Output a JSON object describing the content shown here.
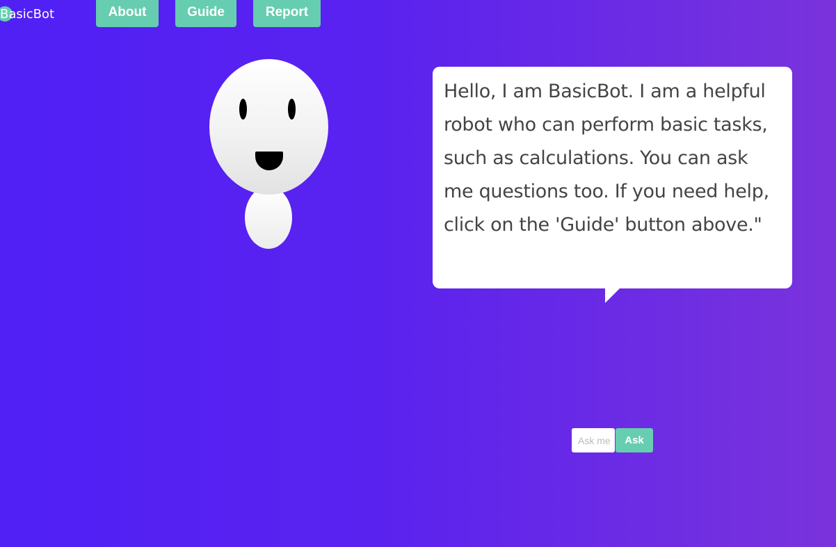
{
  "app": {
    "name": "BasicBot"
  },
  "nav": {
    "about_label": "About",
    "guide_label": "Guide",
    "report_label": "Report"
  },
  "bubble": {
    "message": "Hello, I am BasicBot. I am a helpful robot who can perform basic tasks, such as calculations. You can ask me questions too. If you need help, click on the 'Guide' button above.\""
  },
  "ask": {
    "placeholder": "Ask me",
    "value": "",
    "button_label": "Ask"
  },
  "colors": {
    "accent": "#66cdb0",
    "background_start": "#5020f5",
    "background_end": "#7a33dc",
    "bubble": "#ffffff",
    "bubble_text": "#444444"
  },
  "icons": {
    "logo": "logo-circle-icon"
  }
}
